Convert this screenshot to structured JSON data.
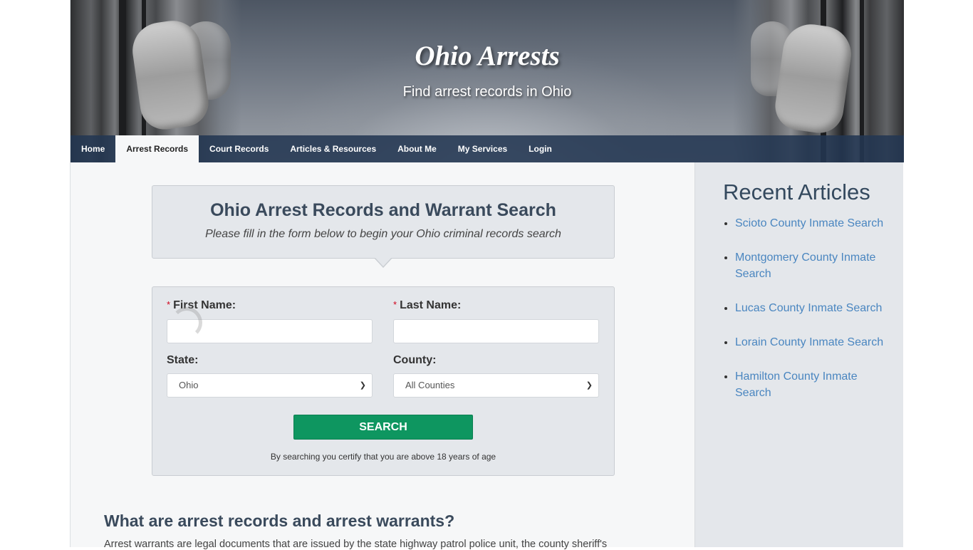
{
  "header": {
    "site_title": "Ohio Arrests",
    "tagline": "Find arrest records in Ohio"
  },
  "nav": {
    "items": [
      {
        "label": "Home",
        "active": false
      },
      {
        "label": "Arrest Records",
        "active": true
      },
      {
        "label": "Court Records",
        "active": false
      },
      {
        "label": "Articles & Resources",
        "active": false
      },
      {
        "label": "About Me",
        "active": false
      },
      {
        "label": "My Services",
        "active": false
      },
      {
        "label": "Login",
        "active": false
      }
    ]
  },
  "search": {
    "title": "Ohio Arrest Records and Warrant Search",
    "subtitle": "Please fill in the form below to begin your Ohio criminal records search",
    "required_marker": "*",
    "first_name": {
      "label": "First Name:",
      "value": "",
      "placeholder": ""
    },
    "last_name": {
      "label": "Last Name:",
      "value": "",
      "placeholder": ""
    },
    "state": {
      "label": "State:",
      "selected": "Ohio"
    },
    "county": {
      "label": "County:",
      "selected": "All Counties"
    },
    "button_label": "SEARCH",
    "disclaimer": "By searching you certify that you are above 18 years of age"
  },
  "article": {
    "heading": "What are arrest records and arrest warrants?",
    "paragraph_start": "Arrest warrants are legal documents that are issued by the state highway patrol police unit, the county sheriff's"
  },
  "sidebar": {
    "title": "Recent Articles",
    "links": [
      "Scioto County Inmate Search",
      "Montgomery County Inmate Search",
      "Lucas County Inmate Search",
      "Lorain County Inmate Search",
      "Hamilton County Inmate Search"
    ]
  },
  "colors": {
    "nav_bg": "#233752",
    "accent_button": "#0e9660",
    "link": "#4a86c0",
    "heading": "#3a4a5c",
    "required": "#d0021b"
  }
}
